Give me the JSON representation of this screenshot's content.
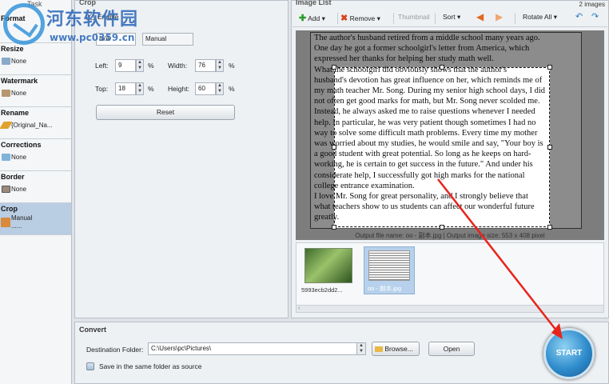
{
  "watermark": {
    "brand": "河东软件园",
    "url": "www.pc0359.cn"
  },
  "tasks": {
    "header": "Task",
    "items": [
      {
        "label": "Format",
        "value": ""
      },
      {
        "label": "Resize",
        "value": "None"
      },
      {
        "label": "Watermark",
        "value": "None"
      },
      {
        "label": "Rename",
        "value": "{Original_Na..."
      },
      {
        "label": "Corrections",
        "value": "None"
      },
      {
        "label": "Border",
        "value": "None"
      },
      {
        "label": "Crop",
        "value": "Manual",
        "extra": "......"
      }
    ]
  },
  "crop": {
    "header": "Crop",
    "enable_label": "Enable",
    "ratio_value": "N/A",
    "mode_value": "Manual",
    "left_label": "Left:",
    "left_value": "9",
    "top_label": "Top:",
    "top_value": "18",
    "width_label": "Width:",
    "width_value": "76",
    "height_label": "Height:",
    "height_value": "60",
    "unit": "%",
    "reset_label": "Reset"
  },
  "image_list": {
    "header": "Image List",
    "count": "2 images",
    "toolbar": {
      "add": "Add",
      "remove": "Remove",
      "thumbnail": "Thumbnail",
      "sort": "Sort",
      "rotate_all": "Rotate All"
    },
    "document_lines": [
      "The author's husband retired from a middle school many years ago.",
      "One day he got a former schoolgirl's letter from America, which",
      "expressed her thanks for helping her study math well.",
      "    What the schoolgirl did obviously shows that the author's",
      "husband's devotion has great influence on her, which reminds me of",
      "my math teacher Mr. Song. During my senior high school days, I did",
      "not often get good marks for math, but Mr. Song never scolded me.",
      "Instead, he always asked me to raise questions whenever I needed",
      "help. In particular, he was very patient though sometimes I had no",
      "way to solve some difficult math problems. Every time my mother",
      "was worried about my studies, he would smile and say, \"Your boy is",
      "a good student with great potential. So long as he keeps on hard-",
      "working, he is certain to get success in the future.\" And under his",
      "considerate help, I successfully got high marks for the national",
      "college entrance examination.",
      "    I love Mr. Song for great personality, and I strongly believe that",
      "what teachers show to us students can affect our wonderful future",
      "greatly."
    ],
    "output_info": "Output file name: oo - 副本.jpg | Output image size: 553 x 408 pixel",
    "thumbnails": [
      {
        "caption": "5993ecb2dd2..."
      },
      {
        "caption": "oo - 副本.jpg"
      }
    ]
  },
  "convert": {
    "header": "Convert",
    "dest_label": "Destination Folder:",
    "dest_value": "C:\\Users\\pc\\Pictures\\",
    "browse_label": "Browse...",
    "open_label": "Open",
    "same_folder_label": "Save in the same folder as source",
    "start_label": "START"
  },
  "colors": {
    "accent": "#2f8ccc",
    "arrow": "#e8241c",
    "selected": "#b9cde3"
  }
}
